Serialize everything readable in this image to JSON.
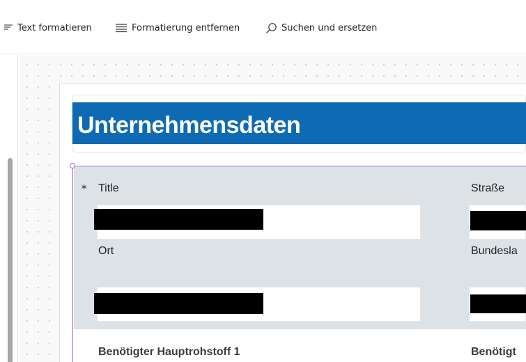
{
  "toolbar": {
    "format_text": "Text formatieren",
    "remove_formatting": "Formatierung entfernen",
    "find_replace": "Suchen und ersetzen"
  },
  "header": {
    "title": "Unternehmensdaten"
  },
  "form": {
    "required_marker": "*",
    "fields": {
      "title": {
        "label": "Title"
      },
      "strasse": {
        "label": "Straße"
      },
      "ort": {
        "label": "Ort"
      },
      "bundesland": {
        "label": "Bundesla"
      },
      "hauptrohstoff1": {
        "label": "Benötigter Hauptrohstoff 1"
      },
      "hauptrohstoff2": {
        "label": "Benötigt"
      }
    }
  },
  "colors": {
    "header_bar": "#0f6ab4",
    "form_grey": "#dce2e6",
    "selection": "#a36ab8"
  }
}
